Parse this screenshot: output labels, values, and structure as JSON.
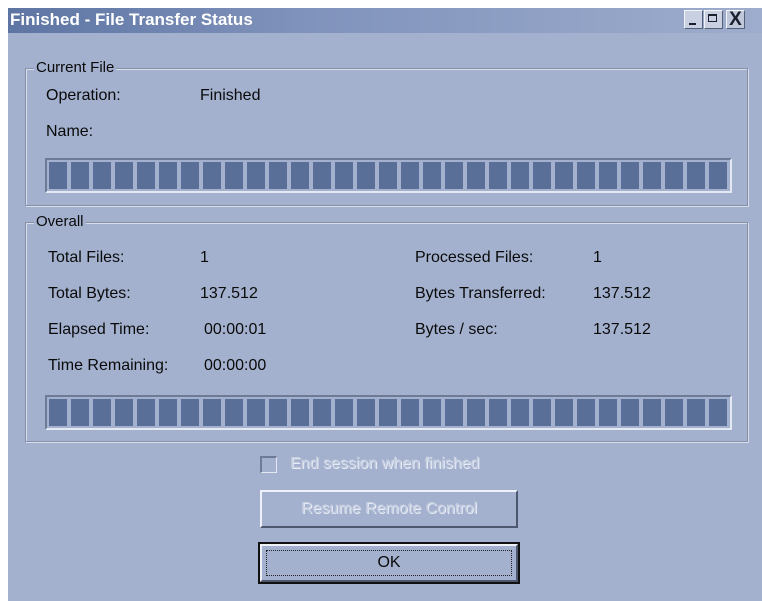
{
  "window": {
    "title": "Finished - File Transfer Status",
    "controls": {
      "minimize_icon": "minimize-icon",
      "maximize_icon": "maximize-icon",
      "close_icon": "close-icon",
      "close_glyph": "X"
    }
  },
  "current_file": {
    "legend": "Current File",
    "operation_label": "Operation:",
    "operation_value": "Finished",
    "name_label": "Name:",
    "name_value": "",
    "progress_fraction": 1.0
  },
  "overall": {
    "legend": "Overall",
    "total_files_label": "Total Files:",
    "total_files_value": "1",
    "processed_files_label": "Processed Files:",
    "processed_files_value": "1",
    "total_bytes_label": "Total Bytes:",
    "total_bytes_value": "137.512",
    "bytes_transferred_label": "Bytes Transferred:",
    "bytes_transferred_value": "137.512",
    "elapsed_time_label": "Elapsed Time:",
    "elapsed_time_value": "00:00:01",
    "bytes_per_sec_label": "Bytes / sec:",
    "bytes_per_sec_value": "137.512",
    "time_remaining_label": "Time Remaining:",
    "time_remaining_value": "00:00:00",
    "progress_fraction": 1.0
  },
  "options": {
    "end_session_label": "End session when finished",
    "end_session_checked": false,
    "end_session_enabled": false
  },
  "buttons": {
    "resume_label": "Resume Remote Control",
    "resume_enabled": false,
    "ok_label": "OK"
  },
  "colors": {
    "window_bg": "#a3b1ce",
    "progress_block": "#5a6f98",
    "title_text": "#ffffff"
  }
}
